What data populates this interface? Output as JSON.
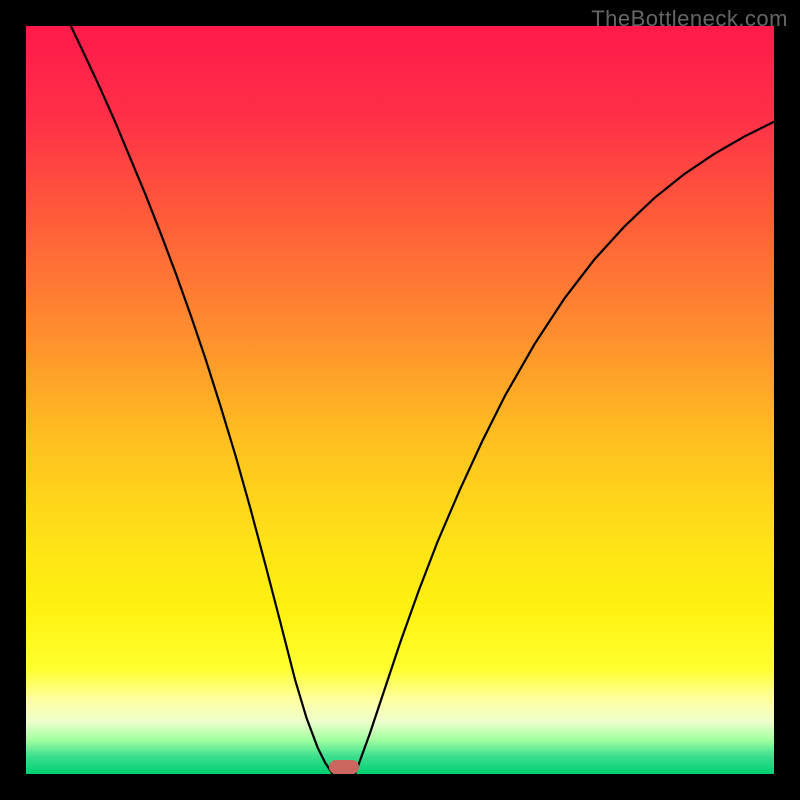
{
  "watermark": "TheBottleneck.com",
  "colors": {
    "background": "#000000",
    "curve": "#000000",
    "marker": "#cc6660",
    "gradient_stops": [
      {
        "offset": 0.0,
        "color": "#ff1a4a"
      },
      {
        "offset": 0.12,
        "color": "#ff2f48"
      },
      {
        "offset": 0.25,
        "color": "#ff5a3a"
      },
      {
        "offset": 0.4,
        "color": "#ff8a30"
      },
      {
        "offset": 0.55,
        "color": "#ffbf20"
      },
      {
        "offset": 0.68,
        "color": "#ffe018"
      },
      {
        "offset": 0.78,
        "color": "#fff210"
      },
      {
        "offset": 0.86,
        "color": "#ffff30"
      },
      {
        "offset": 0.9,
        "color": "#ffffa0"
      },
      {
        "offset": 0.93,
        "color": "#eeffcc"
      },
      {
        "offset": 0.955,
        "color": "#a0ffa0"
      },
      {
        "offset": 0.975,
        "color": "#40e090"
      },
      {
        "offset": 1.0,
        "color": "#00d070"
      }
    ]
  },
  "chart_data": {
    "type": "line",
    "title": "",
    "xlabel": "",
    "ylabel": "",
    "xlim": [
      0,
      1
    ],
    "ylim": [
      0,
      1
    ],
    "series": [
      {
        "name": "left-branch",
        "x": [
          0.06,
          0.08,
          0.1,
          0.12,
          0.14,
          0.16,
          0.18,
          0.2,
          0.22,
          0.24,
          0.26,
          0.28,
          0.3,
          0.32,
          0.34,
          0.36,
          0.375,
          0.39,
          0.4,
          0.41
        ],
        "y": [
          1.0,
          0.958,
          0.915,
          0.87,
          0.822,
          0.774,
          0.723,
          0.67,
          0.614,
          0.555,
          0.492,
          0.426,
          0.355,
          0.28,
          0.203,
          0.125,
          0.075,
          0.035,
          0.015,
          0.0
        ]
      },
      {
        "name": "right-branch",
        "x": [
          0.44,
          0.46,
          0.48,
          0.5,
          0.525,
          0.55,
          0.58,
          0.61,
          0.64,
          0.68,
          0.72,
          0.76,
          0.8,
          0.84,
          0.88,
          0.92,
          0.96,
          1.0
        ],
        "y": [
          0.0,
          0.055,
          0.115,
          0.175,
          0.245,
          0.31,
          0.38,
          0.445,
          0.505,
          0.575,
          0.636,
          0.688,
          0.732,
          0.77,
          0.802,
          0.829,
          0.852,
          0.872
        ]
      }
    ],
    "marker": {
      "x": 0.425,
      "y": 0.01
    },
    "annotations": []
  }
}
